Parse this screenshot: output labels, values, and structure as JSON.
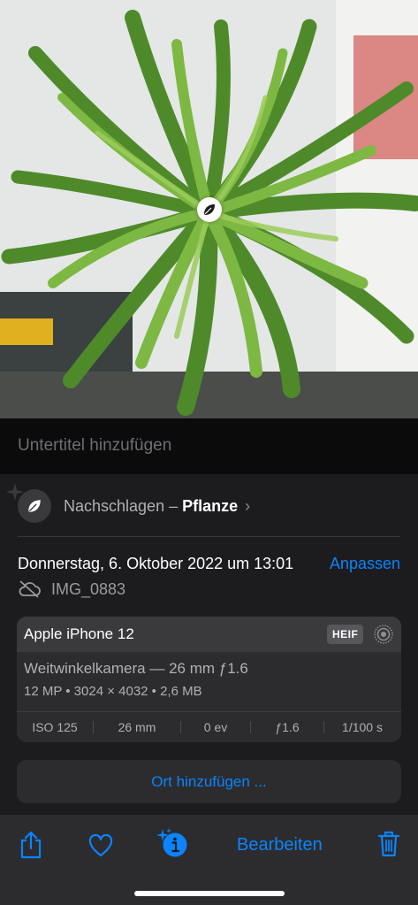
{
  "caption": {
    "placeholder": "Untertitel hinzufügen"
  },
  "lookup": {
    "label": "Nachschlagen –",
    "subject": "Pflanze"
  },
  "meta": {
    "date": "Donnerstag, 6. Oktober 2022 um 13:01",
    "adjust_label": "Anpassen",
    "filename": "IMG_0883"
  },
  "camera": {
    "device": "Apple iPhone 12",
    "format": "HEIF",
    "lens": "Weitwinkelkamera — 26 mm ƒ1.6",
    "specs": "12 MP • 3024 × 4032 • 2,6 MB",
    "exif": [
      "ISO 125",
      "26 mm",
      "0 ev",
      "ƒ1.6",
      "1/100 s"
    ]
  },
  "location": {
    "label": "Ort hinzufügen ..."
  },
  "toolbar": {
    "edit_label": "Bearbeiten"
  },
  "colors": {
    "accent": "#0a84ff",
    "background": "#1c1c1e",
    "card": "#2c2c2e"
  },
  "icons": [
    "share-icon",
    "heart-icon",
    "info-sparkle-icon",
    "trash-icon",
    "leaf-icon",
    "cloud-off-icon",
    "live-photo-icon"
  ]
}
